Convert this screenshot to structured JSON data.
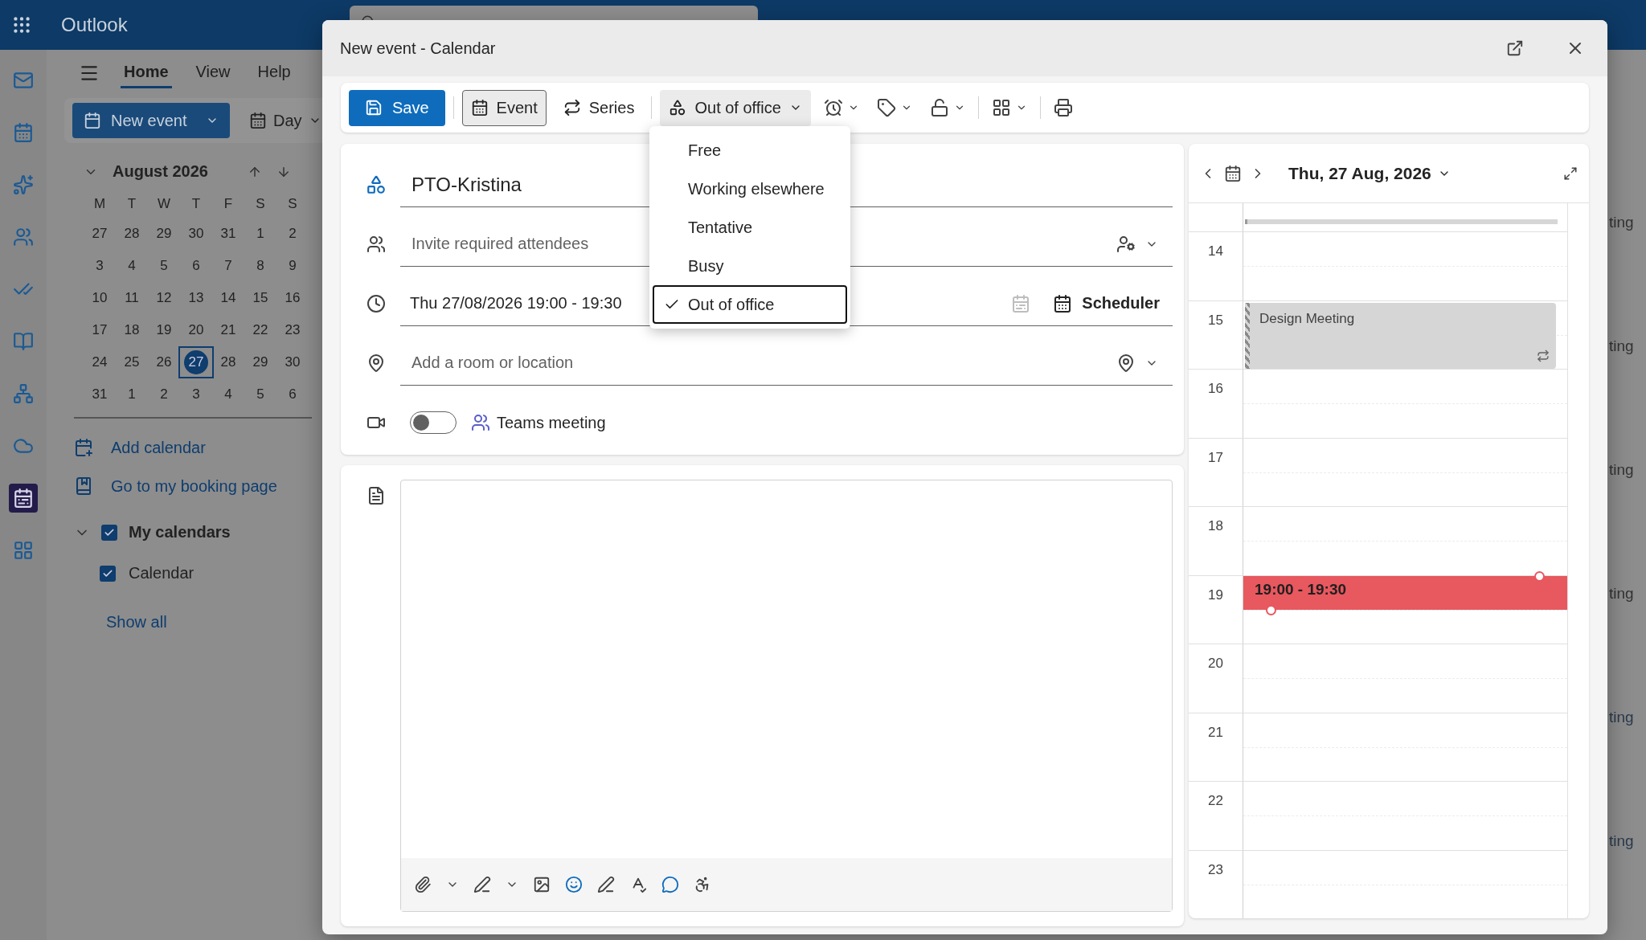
{
  "app": {
    "name": "Outlook"
  },
  "rail_items": [
    {
      "kind": "mail",
      "selected": false
    },
    {
      "kind": "calendar",
      "selected": false
    },
    {
      "kind": "copilot",
      "selected": false
    },
    {
      "kind": "people",
      "selected": false
    },
    {
      "kind": "todo",
      "selected": false
    },
    {
      "kind": "notebook",
      "selected": false
    },
    {
      "kind": "org",
      "selected": false
    },
    {
      "kind": "cloud",
      "selected": false
    },
    {
      "kind": "bookings",
      "selected": true
    },
    {
      "kind": "apps",
      "selected": false
    }
  ],
  "ribbon_tabs": [
    {
      "label": "Home",
      "selected": true
    },
    {
      "label": "View",
      "selected": false
    },
    {
      "label": "Help",
      "selected": false
    }
  ],
  "ribbon": {
    "new_event": "New event",
    "view": "Day"
  },
  "mini_calendar": {
    "month": "August 2026",
    "weekdays": [
      "M",
      "T",
      "W",
      "T",
      "F",
      "S",
      "S"
    ],
    "weeks": [
      [
        {
          "day": "27",
          "selected": false
        },
        {
          "day": "28",
          "selected": false
        },
        {
          "day": "29",
          "selected": false
        },
        {
          "day": "30",
          "selected": false
        },
        {
          "day": "31",
          "selected": false
        },
        {
          "day": "1",
          "selected": false
        },
        {
          "day": "2",
          "selected": false
        }
      ],
      [
        {
          "day": "3",
          "selected": false
        },
        {
          "day": "4",
          "selected": false
        },
        {
          "day": "5",
          "selected": false
        },
        {
          "day": "6",
          "selected": false
        },
        {
          "day": "7",
          "selected": false
        },
        {
          "day": "8",
          "selected": false
        },
        {
          "day": "9",
          "selected": false
        }
      ],
      [
        {
          "day": "10",
          "selected": false
        },
        {
          "day": "11",
          "selected": false
        },
        {
          "day": "12",
          "selected": false
        },
        {
          "day": "13",
          "selected": false
        },
        {
          "day": "14",
          "selected": false
        },
        {
          "day": "15",
          "selected": false
        },
        {
          "day": "16",
          "selected": false
        }
      ],
      [
        {
          "day": "17",
          "selected": false
        },
        {
          "day": "18",
          "selected": false
        },
        {
          "day": "19",
          "selected": false
        },
        {
          "day": "20",
          "selected": false
        },
        {
          "day": "21",
          "selected": false
        },
        {
          "day": "22",
          "selected": false
        },
        {
          "day": "23",
          "selected": false
        }
      ],
      [
        {
          "day": "24",
          "selected": false
        },
        {
          "day": "25",
          "selected": false
        },
        {
          "day": "26",
          "selected": false
        },
        {
          "day": "27",
          "selected": true
        },
        {
          "day": "28",
          "selected": false
        },
        {
          "day": "29",
          "selected": false
        },
        {
          "day": "30",
          "selected": false
        }
      ],
      [
        {
          "day": "31",
          "selected": false
        },
        {
          "day": "1",
          "selected": false
        },
        {
          "day": "2",
          "selected": false
        },
        {
          "day": "3",
          "selected": false
        },
        {
          "day": "4",
          "selected": false
        },
        {
          "day": "5",
          "selected": false
        },
        {
          "day": "6",
          "selected": false
        }
      ]
    ]
  },
  "links": [
    {
      "kind": "add",
      "label": "Add calendar"
    },
    {
      "kind": "booking",
      "label": "Go to my booking page"
    }
  ],
  "my_calendars": {
    "label": "My calendars",
    "checked": true,
    "expanded": true,
    "items": [
      {
        "label": "Calendar",
        "checked": true
      }
    ]
  },
  "show_all": "Show all",
  "background_events": [
    "ting",
    "ting",
    "ting",
    "ting",
    "ting",
    "ting"
  ],
  "dialog": {
    "title": "New event - Calendar",
    "toolbar": {
      "save": "Save",
      "event": {
        "label": "Event",
        "selected": true
      },
      "series": "Series",
      "show_as": "Out of office"
    },
    "show_as_menu": [
      {
        "label": "Free",
        "selected": false
      },
      {
        "label": "Working elsewhere",
        "selected": false
      },
      {
        "label": "Tentative",
        "selected": false
      },
      {
        "label": "Busy",
        "selected": false
      },
      {
        "label": "Out of office",
        "selected": true
      }
    ],
    "form": {
      "title": "PTO-Kristina",
      "attendees_placeholder": "Invite required attendees",
      "datetime": "Thu 27/08/2026 19:00 - 19:30",
      "scheduler": "Scheduler",
      "location_placeholder": "Add a room or location",
      "teams": {
        "label": "Teams meeting",
        "on": false
      }
    },
    "day_panel": {
      "date": "Thu, 27 Aug, 2026",
      "hours": [
        {
          "label": "14"
        },
        {
          "label": "15",
          "events": [
            {
              "kind": "busy",
              "title": "Design Meeting",
              "recurring": true
            }
          ]
        },
        {
          "label": "16"
        },
        {
          "label": "17"
        },
        {
          "label": "18"
        },
        {
          "label": "19",
          "events": [
            {
              "kind": "draft",
              "title": "19:00 - 19:30"
            }
          ]
        },
        {
          "label": "20"
        },
        {
          "label": "21"
        },
        {
          "label": "22"
        },
        {
          "label": "23"
        }
      ]
    }
  }
}
